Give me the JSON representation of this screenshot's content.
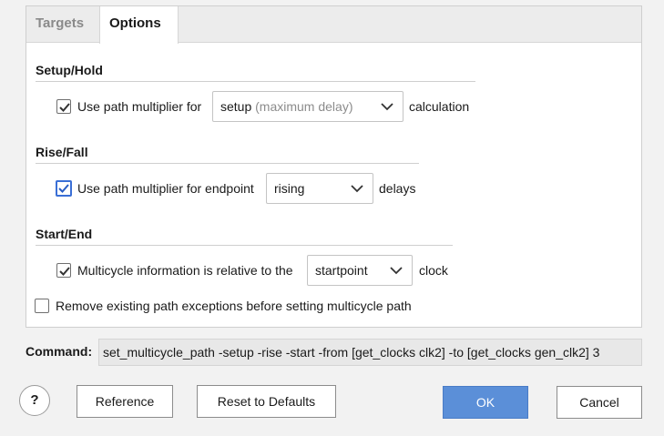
{
  "tabs": {
    "targets": "Targets",
    "options": "Options"
  },
  "setup_hold": {
    "title": "Setup/Hold",
    "checkbox_checked": true,
    "label": "Use path multiplier for",
    "combo_value": "setup",
    "combo_hint": "(maximum delay)",
    "suffix": "calculation"
  },
  "rise_fall": {
    "title": "Rise/Fall",
    "checkbox_checked": true,
    "label": "Use path multiplier for endpoint",
    "combo_value": "rising",
    "suffix": "delays"
  },
  "start_end": {
    "title": "Start/End",
    "checkbox_checked": true,
    "label": "Multicycle information is relative to the",
    "combo_value": "startpoint",
    "suffix": "clock"
  },
  "remove_exceptions": {
    "checkbox_checked": false,
    "label": "Remove existing path exceptions before setting multicycle path"
  },
  "command": {
    "label": "Command:",
    "value": "set_multicycle_path -setup -rise -start -from [get_clocks clk2] -to [get_clocks gen_clk2] 3"
  },
  "buttons": {
    "help": "?",
    "reference": "Reference",
    "reset": "Reset to Defaults",
    "ok": "OK",
    "cancel": "Cancel"
  },
  "colors": {
    "accent": "#5b8fd8",
    "focus_border": "#3a6fd6"
  },
  "icons": [
    "check-icon",
    "chevron-down-icon",
    "help-icon"
  ]
}
